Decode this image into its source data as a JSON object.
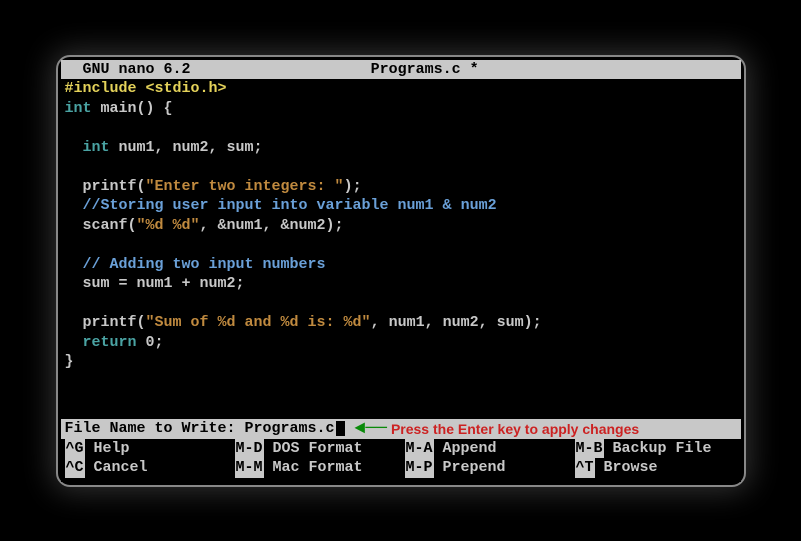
{
  "titlebar": {
    "left": "  GNU nano 6.2",
    "center": "Programs.c *"
  },
  "code": {
    "line1_include": "#include",
    "line1_header": " <stdio.h>",
    "line2_int": "int",
    "line2_rest": " main() {",
    "line4_int": "  int",
    "line4_rest": " num1, num2, sum;",
    "line6_pre": "  printf(",
    "line6_str": "\"Enter two integers: \"",
    "line6_post": ");",
    "line7_cmt": "  //Storing user input into variable num1 & num2",
    "line8_pre": "  scanf(",
    "line8_str": "\"%d %d\"",
    "line8_post": ", &num1, &num2);",
    "line10_cmt": "  // Adding two input numbers",
    "line11": "  sum = num1 + num2;",
    "line13_pre": "  printf(",
    "line13_str": "\"Sum of %d and %d is: %d\"",
    "line13_post": ", num1, num2, sum);",
    "line14_ret": "  return",
    "line14_rest": " 0;",
    "line15": "}"
  },
  "prompt": {
    "label": "File Name to Write: ",
    "value": "Programs.c",
    "annotation": "Press the Enter key to apply changes"
  },
  "shortcuts": {
    "row1": [
      {
        "key": "^G",
        "label": " Help"
      },
      {
        "key": "M-D",
        "label": " DOS Format"
      },
      {
        "key": "M-A",
        "label": " Append"
      },
      {
        "key": "M-B",
        "label": " Backup File"
      }
    ],
    "row2": [
      {
        "key": "^C",
        "label": " Cancel"
      },
      {
        "key": "M-M",
        "label": " Mac Format"
      },
      {
        "key": "M-P",
        "label": " Prepend"
      },
      {
        "key": "^T",
        "label": " Browse"
      }
    ]
  }
}
